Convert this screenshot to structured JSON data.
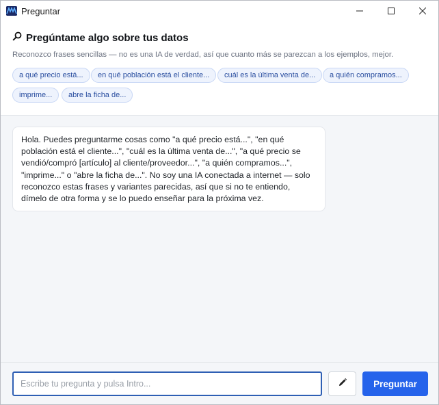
{
  "window": {
    "title": "Preguntar",
    "app_icon": "app-logo-icon",
    "controls": [
      "minimize-icon",
      "maximize-icon",
      "close-icon"
    ]
  },
  "header": {
    "icon": "search-icon",
    "title": "Pregúntame algo sobre tus datos",
    "subtitle": "Reconozco frases sencillas — no es una IA de verdad, así que cuanto más se parezcan a los ejemplos, mejor.",
    "chips": [
      "a qué precio está...",
      "en qué población está el cliente...",
      "cuál es la última venta de...",
      "a quién compramos...",
      "imprime...",
      "abre la ficha de..."
    ]
  },
  "chat": {
    "messages": [
      {
        "role": "assistant",
        "text": "Hola. Puedes preguntarme cosas como \"a qué precio está...\", \"en qué población está el cliente...\", \"cuál es la última venta de...\", \"a qué precio se vendió/compró [artículo] al cliente/proveedor...\", \"a quién compramos...\", \"imprime...\" o \"abre la ficha de...\". No soy una IA conectada a internet — solo reconozco estas frases y variantes parecidas, así que si no te entiendo, dímelo de otra forma y se lo puedo enseñar para la próxima vez."
      }
    ]
  },
  "footer": {
    "input_value": "",
    "input_placeholder": "Escribe tu pregunta y pulsa Intro...",
    "edit_icon": "pencil-icon",
    "ask_label": "Preguntar"
  },
  "colors": {
    "accent": "#2563eb",
    "input_border": "#2e5fb4",
    "chip_bg": "#eef3fd",
    "chip_border": "#c7d6f5",
    "chip_text": "#2b4fa0",
    "chat_bg": "#f4f6f9"
  }
}
